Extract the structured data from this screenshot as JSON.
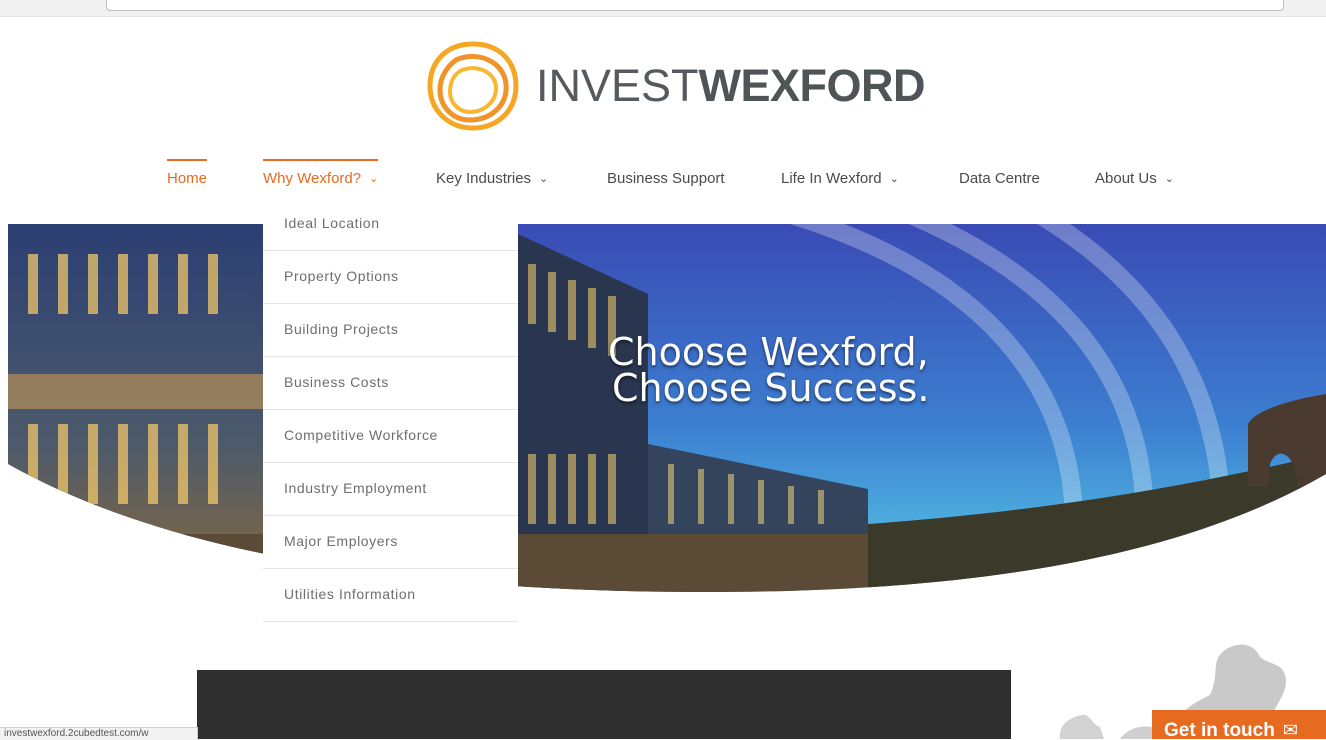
{
  "browser": {
    "status_url": "investwexford.2cubedtest.com/w"
  },
  "logo": {
    "text_light": "INVEST",
    "text_bold": "WEXFORD",
    "icon": "swirl-logo-icon"
  },
  "nav": {
    "items": [
      {
        "label": "Home",
        "state": "current"
      },
      {
        "label": "Why Wexford?",
        "state": "open",
        "has_dropdown": true
      },
      {
        "label": "Key Industries",
        "has_dropdown": true
      },
      {
        "label": "Business Support"
      },
      {
        "label": "Life In Wexford",
        "has_dropdown": true
      },
      {
        "label": "Data Centre"
      },
      {
        "label": "About Us",
        "has_dropdown": true
      }
    ],
    "chevron": "⌄"
  },
  "dropdown": {
    "items": [
      "Ideal Location",
      "Property Options",
      "Building Projects",
      "Business Costs",
      "Competitive Workforce",
      "Industry Employment",
      "Major Employers",
      "Utilities Information"
    ]
  },
  "hero": {
    "headline_line1": "Choose Wexford,",
    "headline_line2": "Choose Success."
  },
  "cta": {
    "label": "Get in touch",
    "icon": "envelope-icon"
  },
  "colors": {
    "accent": "#e66a1f",
    "logo_orange": "#f2a12b",
    "text": "#4a4a4a",
    "dark_panel": "#2f2f2f"
  }
}
